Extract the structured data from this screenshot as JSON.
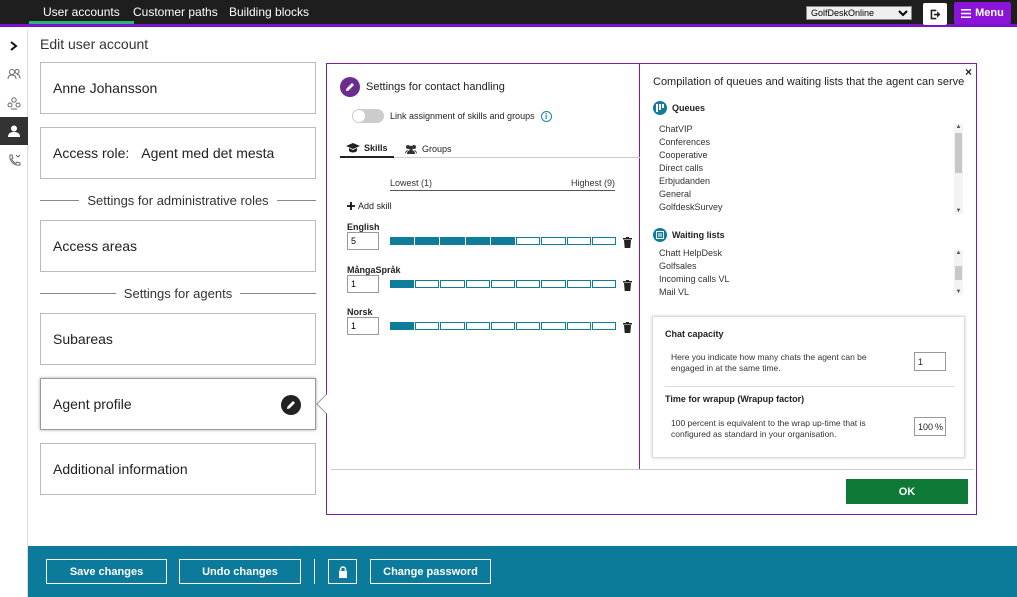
{
  "topbar": {
    "tabs": [
      "User accounts",
      "Customer paths",
      "Building blocks"
    ],
    "org_select": "GolfDeskOnline",
    "menu_label": "Menu"
  },
  "page": {
    "title": "Edit user account"
  },
  "cards": {
    "name": "Anne Johansson",
    "access_role_label": "Access role:",
    "access_role_value": "Agent med det mesta",
    "section_admin": "Settings for administrative roles",
    "access_areas": "Access areas",
    "section_agents": "Settings for agents",
    "subareas": "Subareas",
    "agent_profile": "Agent profile",
    "additional_info": "Additional information"
  },
  "dialog": {
    "settings_title": "Settings for contact handling",
    "link_toggle_label": "Link assignment of skills and groups",
    "tabs": [
      "Skills",
      "Groups"
    ],
    "scale_low": "Lowest (1)",
    "scale_high": "Highest (9)",
    "add_skill": "Add skill",
    "skills": [
      {
        "name": "English",
        "level": 5
      },
      {
        "name": "MångaSpråk",
        "level": 1
      },
      {
        "name": "Norsk",
        "level": 1
      }
    ],
    "right_title": "Compilation of queues and waiting lists that the agent can serve",
    "queues_label": "Queues",
    "queues": [
      "ChatVIP",
      "Conferences",
      "Cooperative",
      "Direct calls",
      "Erbjudanden",
      "General",
      "GolfdeskSurvey"
    ],
    "waiting_lists_label": "Waiting lists",
    "waiting_lists": [
      "Chatt HelpDesk",
      "Golfsales",
      "Incoming calls VL",
      "Mail VL"
    ],
    "chat_capacity_title": "Chat capacity",
    "chat_capacity_desc": "Here you indicate how many chats the agent can be engaged in at the same time.",
    "chat_capacity_value": "1",
    "wrapup_title": "Time for wrapup (Wrapup factor)",
    "wrapup_desc": "100 percent is equivalent to the wrap up-time that is configured as standard in your organisation.",
    "wrapup_value": "100",
    "wrapup_unit": "%",
    "ok_label": "OK",
    "close_label": "×"
  },
  "footer": {
    "save": "Save changes",
    "undo": "Undo changes",
    "change_password": "Change password"
  },
  "colors": {
    "accent_purple": "#7a12c8",
    "teal": "#0b7a9b",
    "ok_green": "#0f7a37"
  }
}
